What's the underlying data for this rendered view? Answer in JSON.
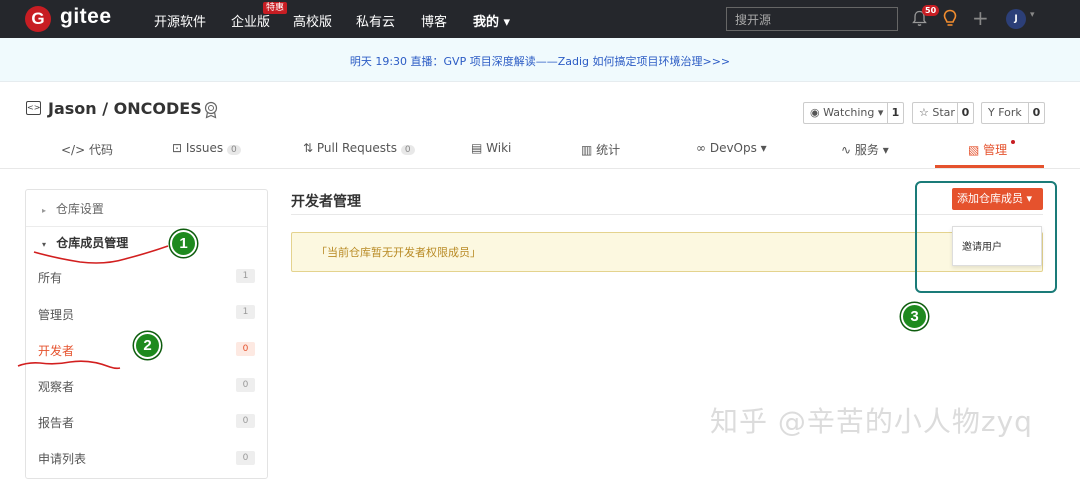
{
  "topbar": {
    "logo_letter": "G",
    "logo_text": "gitee",
    "nav": [
      "开源软件",
      "企业版",
      "高校版",
      "私有云",
      "博客",
      "我的 ▾"
    ],
    "nav_badge": "特惠",
    "search_placeholder": "搜开源",
    "notification_count": "50",
    "plus": "+",
    "avatar_initial": "J",
    "avatar_caret": "▾"
  },
  "banner": {
    "text": "明天 19:30 直播：GVP 项目深度解读——Zadig 如何搞定项目环境治理>>>"
  },
  "repo": {
    "icon": "<>",
    "title": "Jason / ONCODES",
    "watching_label": "Watching ▾",
    "watching_count": "1",
    "star_label": "Star",
    "star_count": "0",
    "fork_label": "Fork",
    "fork_count": "0"
  },
  "tabs": [
    {
      "label": "代码",
      "icon": "</>"
    },
    {
      "label": "Issues",
      "icon": "⊡",
      "count": "0"
    },
    {
      "label": "Pull Requests",
      "icon": "⇅",
      "count": "0"
    },
    {
      "label": "Wiki",
      "icon": "▤"
    },
    {
      "label": "统计",
      "icon": "▥"
    },
    {
      "label": "DevOps ▾",
      "icon": "∞"
    },
    {
      "label": "服务 ▾",
      "icon": "∿"
    },
    {
      "label": "管理",
      "icon": "▧"
    }
  ],
  "sidebar": {
    "settings": "仓库设置",
    "members_heading": "仓库成员管理",
    "items": [
      {
        "label": "所有",
        "count": "1"
      },
      {
        "label": "管理员",
        "count": "1"
      },
      {
        "label": "开发者",
        "count": "0"
      },
      {
        "label": "观察者",
        "count": "0"
      },
      {
        "label": "报告者",
        "count": "0"
      },
      {
        "label": "申请列表",
        "count": "0"
      }
    ]
  },
  "main": {
    "title": "开发者管理",
    "add_button": "添加仓库成员 ▾",
    "alert": "「当前仓库暂无开发者权限成员」",
    "dropdown_item": "邀请用户"
  },
  "annotations": {
    "steps": [
      "1",
      "2",
      "3"
    ]
  },
  "watermark": "知乎 @辛苦的小人物zyq",
  "colors": {
    "topbar": "#25272c",
    "brand": "#c71d23",
    "accent": "#e5522d",
    "banner_link": "#2c5cc5",
    "annotation_green": "#1e8a1e",
    "annotation_box": "#1a7b78",
    "underline_red": "#d21f1f"
  }
}
